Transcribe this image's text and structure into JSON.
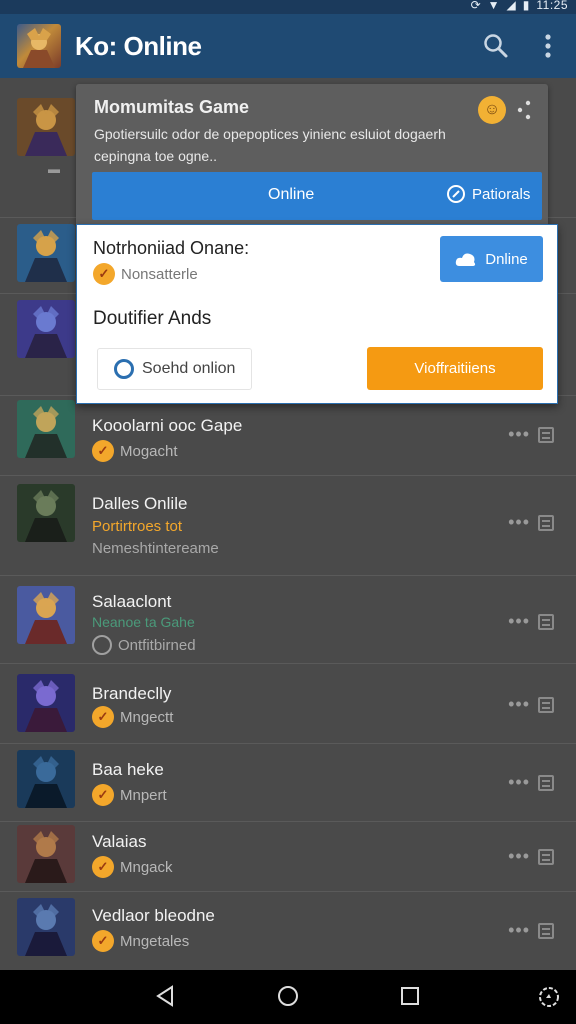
{
  "status_bar": {
    "time": "11:25"
  },
  "app_bar": {
    "title": "Ko: Online"
  },
  "popup": {
    "title": "Momumitas Game",
    "description": "Gpotiersuilc odor de opepoptices yinienc esluiot dogaerh cepingna toe ogne..",
    "online_label": "Online",
    "rationale_label": "Patiorals",
    "notification_title": "Notrhoniiad Onane:",
    "notification_status": "Nonsatterle",
    "online_button": "Dnline",
    "sub_title": "Doutifier Ands",
    "search_button": "Soehd onlion",
    "action_button": "Vioffraitiiens"
  },
  "list": [
    {
      "title": "",
      "sub": "",
      "sub2": "",
      "badge": "none",
      "avatar_colors": [
        "#6a4a2a",
        "#c99545",
        "#3a2a5a"
      ]
    },
    {
      "title": "",
      "sub": "",
      "sub2": "",
      "badge": "none",
      "avatar_colors": [
        "#2b5d8a",
        "#d6a24a",
        "#1f2f4a"
      ]
    },
    {
      "title": "",
      "sub": "",
      "sub2": "",
      "badge": "none",
      "avatar_colors": [
        "#3d3a8a",
        "#6a7ad0",
        "#2a2348"
      ]
    },
    {
      "title": "Kooolarni ooc Gape",
      "sub": "Mogacht",
      "sub2": "",
      "badge": "orange",
      "sub_color": "#b8b8b8",
      "avatar_colors": [
        "#2f6a5a",
        "#c0a45a",
        "#22302a"
      ]
    },
    {
      "title": "Dalles Onlile",
      "sub": "Portirtroes tot",
      "sub2": "Nemeshtintereame",
      "badge": "none",
      "sub_color": "#f3a72b",
      "avatar_colors": [
        "#2a3a2a",
        "#6a7c5a",
        "#1a1f1a"
      ]
    },
    {
      "title": "Salaaclont",
      "sub": "Neanoe ta Gahe",
      "sub2": "Ontfitbirned",
      "badge": "none",
      "sub_color": "#4a9a7a",
      "avatar_colors": [
        "#4a5aa0",
        "#d9a552",
        "#6a2a2a"
      ]
    },
    {
      "title": "Brandeclly",
      "sub": "Mngectt",
      "sub2": "",
      "badge": "orange",
      "sub_color": "#b8b8b8",
      "avatar_colors": [
        "#2a2a6a",
        "#7a6ad0",
        "#3a1a3a"
      ]
    },
    {
      "title": "Baa heke",
      "sub": "Mnpert",
      "sub2": "",
      "badge": "orange",
      "sub_color": "#b8b8b8",
      "avatar_colors": [
        "#1a3a5a",
        "#3a6a9a",
        "#0a1a2a"
      ]
    },
    {
      "title": "Valaias",
      "sub": "Mngack",
      "sub2": "",
      "badge": "orange",
      "sub_color": "#b8b8b8",
      "avatar_colors": [
        "#5a3a3a",
        "#b07a4a",
        "#2a1a1a"
      ]
    },
    {
      "title": "Vedlaor bleodne",
      "sub": "Mngetales",
      "sub2": "",
      "badge": "orange",
      "sub_color": "#b8b8b8",
      "avatar_colors": [
        "#2a3a6a",
        "#5a7ab0",
        "#1a1a3a"
      ]
    }
  ],
  "colors": {
    "app_bar": "#1f4a73",
    "primary_blue": "#2b7fd3",
    "accent_orange": "#f59a12",
    "list_bg": "#4a4a4a"
  }
}
